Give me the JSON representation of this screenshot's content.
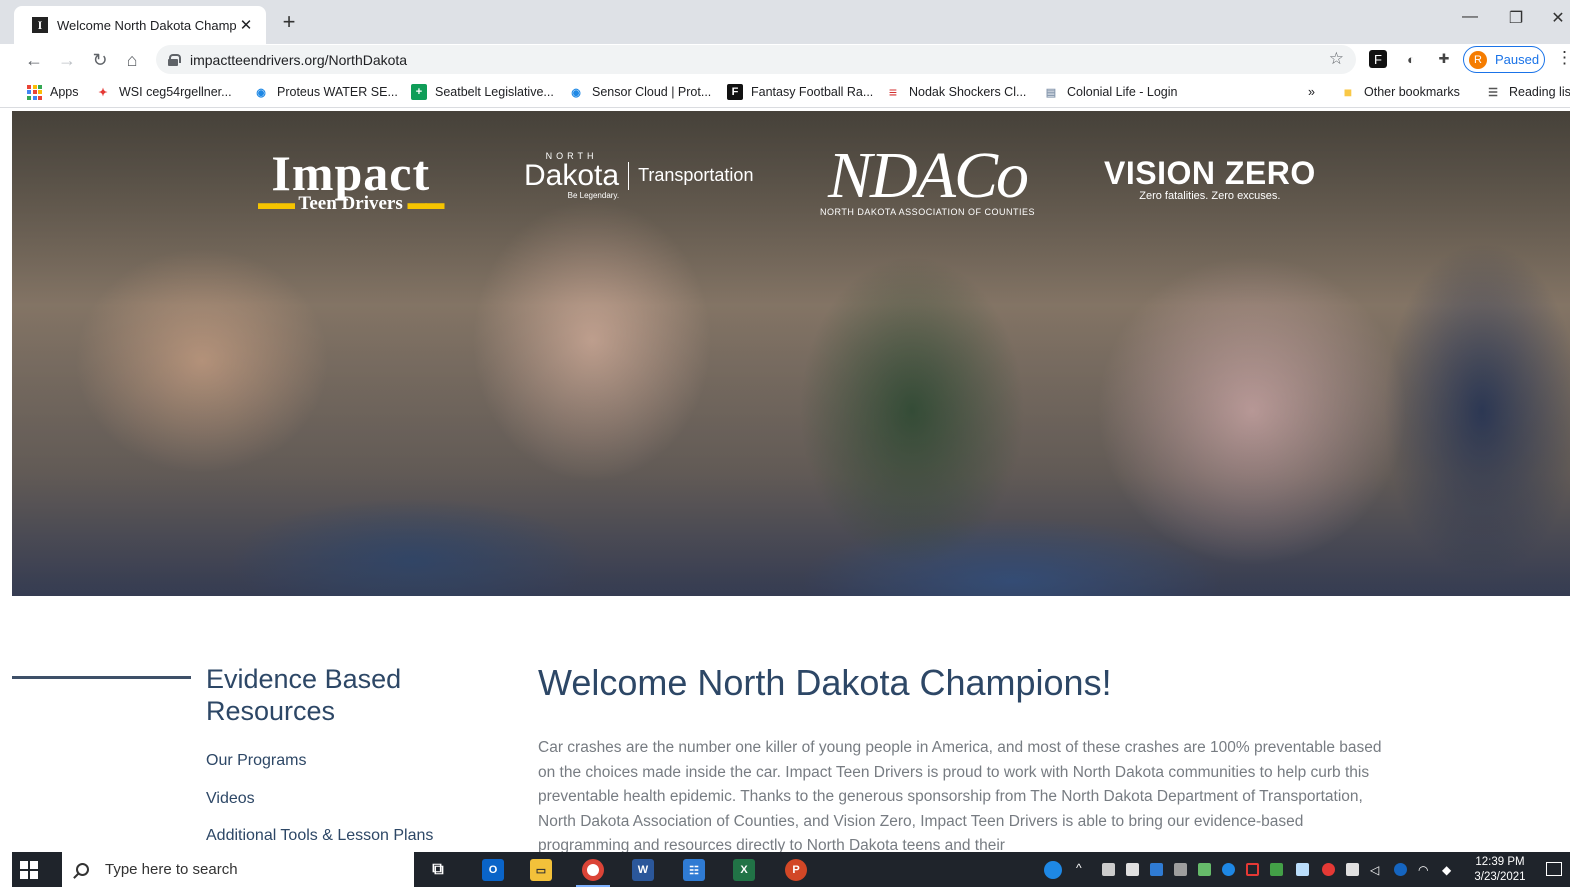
{
  "browser": {
    "tab_title": "Welcome North Dakota Champic",
    "tab_favicon": "I",
    "url": "impactteendrivers.org/NorthDakota",
    "profile_initial": "R",
    "profile_status": "Paused"
  },
  "bookmarks": [
    {
      "label": "Apps",
      "icon": "apps-grid-icon"
    },
    {
      "label": "WSI ceg54rgellner...",
      "icon": "pinwheel-icon"
    },
    {
      "label": "Proteus WATER SE...",
      "icon": "globe-icon"
    },
    {
      "label": "Seatbelt Legislative...",
      "icon": "sheets-plus-icon"
    },
    {
      "label": "Sensor Cloud | Prot...",
      "icon": "globe-icon"
    },
    {
      "label": "Fantasy Football Ra...",
      "icon": "f-logo-icon"
    },
    {
      "label": "Nodak Shockers Cl...",
      "icon": "red-e-icon"
    },
    {
      "label": "Colonial Life - Login",
      "icon": "doc-icon"
    }
  ],
  "bookmarks_overflow": "»",
  "other_bookmarks": "Other bookmarks",
  "reading_list": "Reading lis",
  "hero": {
    "logos": {
      "impact_main": "Impact",
      "impact_sub_left": "Teen",
      "impact_sub_right": "Drivers",
      "nd_north": "NORTH",
      "nd_dakota": "Dakota",
      "nd_legendary": "Be Legendary.",
      "nd_transportation": "Transportation",
      "ndaco_main": "NDACo",
      "ndaco_sub": "NORTH DAKOTA ASSOCIATION OF COUNTIES",
      "vz_main": "VISION ZERO",
      "vz_sub": "Zero fatalities. Zero excuses."
    }
  },
  "sidebar": {
    "heading": "Evidence Based Resources",
    "links": [
      "Our Programs",
      "Videos",
      "Additional Tools & Lesson Plans"
    ]
  },
  "main": {
    "heading": "Welcome North Dakota Champions!",
    "body": "Car crashes are the number one killer of young people in America, and most of these crashes are 100% preventable based on the choices made inside the car. Impact Teen Drivers is proud to work with North Dakota communities to help curb this preventable health epidemic. Thanks to the generous sponsorship from The North Dakota Department of Transportation, North Dakota Association of Counties, and Vision Zero, Impact Teen Drivers is able to bring our evidence-based programming and resources directly to North Dakota teens and their"
  },
  "taskbar": {
    "search_placeholder": "Type here to search",
    "time": "12:39 PM",
    "date": "3/23/2021"
  },
  "colors": {
    "heading": "#2d4766",
    "body_text": "#777c82",
    "taskbar": "#1f242b",
    "accent_blue": "#1a73e8"
  }
}
